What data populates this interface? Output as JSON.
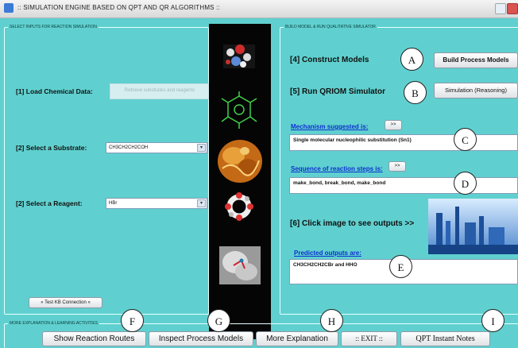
{
  "window": {
    "title": ":: SIMULATION ENGINE BASED ON QPT AND QR ALGORITHMS ::"
  },
  "left_panel": {
    "group_title": "SELECT INPUTS FOR REACTION SIMULATION",
    "load_label": "[1]   Load Chemical Data:",
    "load_button": "Retrieve substrates and reagents",
    "substrate_label": "[2]   Select a Substrate:",
    "substrate_value": "CH3CH2CH2COH",
    "reagent_label": "[2]   Select a Reagent:",
    "reagent_value": "HBr",
    "test_kb_button": "» Test KB Connection «"
  },
  "right_panel": {
    "group_title": "BUILD MODEL & RUN QUALITATIVE SIMULATOR",
    "construct_label": "[4]    Construct Models",
    "build_button": "Build Process Models",
    "run_label": "[5]    Run QRIOM Simulator",
    "simulation_button": "Simulation (Reasoning)",
    "mechanism_label": "Mechanism suggested is:",
    "mechanism_button": ">>",
    "mechanism_value": "Single molecular nucleophilic substitution (Sn1)",
    "sequence_label": "Sequence of reaction steps is:",
    "sequence_button": ">>",
    "sequence_value": "make_bond,  break_bond, make_bond",
    "outputs_label": "[6]    Click image to see outputs >>",
    "predicted_label": "Predicted outputs are:",
    "predicted_value": "CH3CH2CH2CBr  and HHO"
  },
  "bottom": {
    "group_title": "MORE EXPLANATION & LEARNING ACTIVITIES",
    "buttons": [
      "Show Reaction Routes",
      "Inspect Process Models",
      "More Explanation",
      ":: EXIT ::",
      "QPT Instant Notes"
    ]
  },
  "callouts": [
    "A",
    "B",
    "C",
    "D",
    "E",
    "F",
    "G",
    "H",
    "I"
  ],
  "colors": {
    "background": "#5fd0cf",
    "link_blue": "#1030d0"
  }
}
